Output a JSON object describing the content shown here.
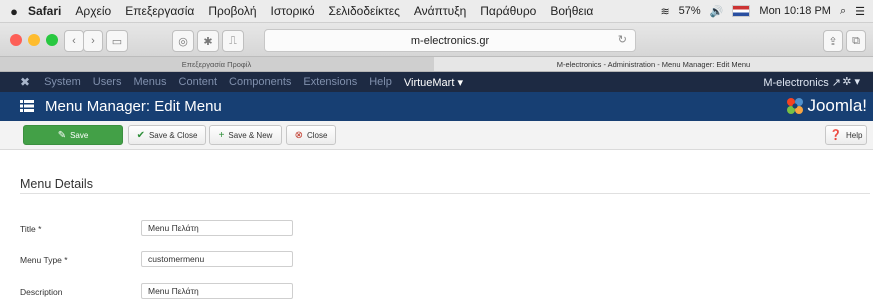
{
  "macos": {
    "apple": "",
    "menus": [
      "Safari",
      "Αρχείο",
      "Επεξεργασία",
      "Προβολή",
      "Ιστορικό",
      "Σελιδοδείκτες",
      "Ανάπτυξη",
      "Παράθυρο",
      "Βοήθεια"
    ],
    "battery": "57%",
    "clock": "Mon 10:18 PM"
  },
  "safari": {
    "url": "m-electronics.gr",
    "tabs": [
      {
        "label": "Επεξεργασία Προφίλ",
        "active": false
      },
      {
        "label": "M-electronics - Administration - Menu Manager: Edit Menu",
        "active": true
      }
    ]
  },
  "joomla_nav": {
    "items": [
      "System",
      "Users",
      "Menus",
      "Content",
      "Components",
      "Extensions",
      "Help"
    ],
    "virtuemart": "VirtueMart ▾",
    "site": "M-electronics ↗",
    "gear": "✲ ▾"
  },
  "header": {
    "title": "Menu Manager: Edit Menu",
    "logo": "Joomla!"
  },
  "actions": {
    "save": "Save",
    "save_close": "Save & Close",
    "save_new": "Save & New",
    "close": "Close",
    "help": "Help"
  },
  "form": {
    "section_title": "Menu Details",
    "fields": [
      {
        "label": "Title *",
        "value": "Menu Πελάτη"
      },
      {
        "label": "Menu Type *",
        "value": "customermenu"
      },
      {
        "label": "Description",
        "value": "Menu Πελάτη"
      }
    ]
  },
  "colors": {
    "joomla_nav_bg": "#1d2a43",
    "header_bg": "#173f73",
    "save_green": "#43a047"
  },
  "icons": [
    "apple-icon",
    "wifi-icon",
    "volume-icon",
    "search-icon",
    "list-icon",
    "share-icon",
    "tabs-icon",
    "menu-list-icon",
    "joomla-logo-icon",
    "gear-icon",
    "edit-icon",
    "check-icon",
    "plus-icon",
    "close-circle-icon",
    "help-icon"
  ]
}
